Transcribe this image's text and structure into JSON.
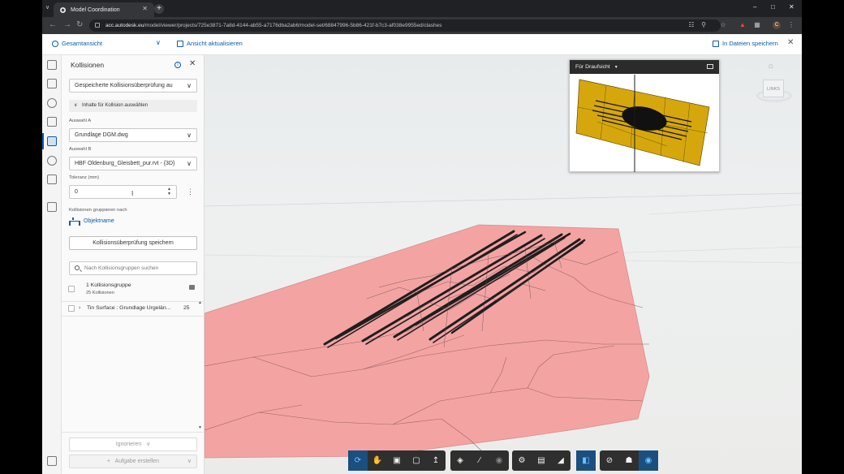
{
  "browser": {
    "tab_title": "Model Coordination",
    "url_host": "acc.autodesk.eu",
    "url_path": "/model/viewer/projects/725e3871-7a8d-4144-ab55-a7176dba2ab6/model-set/68847996-5b86-421f-b7c3-af038e9955ed/clashes",
    "profile_initial": "C"
  },
  "header": {
    "view_selector": "Gesamtansicht",
    "refresh_label": "Ansicht aktualisieren",
    "save_label": "In Dateien speichern"
  },
  "panel": {
    "title": "Kollisionen",
    "saved_dropdown": "Gespeicherte Kollisionsüberprüfung au",
    "section_label": "Inhalte für Kollision auswählen",
    "selection_a_label": "Auswahl A",
    "selection_a_value": "Grundlage DGM.dwg",
    "selection_b_label": "Auswahl B",
    "selection_b_value": "HBF Oldenburg_Gleisbett_pur.rvt - {3D}",
    "tolerance_label": "Toleranz (mm)",
    "tolerance_value": "0",
    "group_by_label": "Kollisionen gruppieren nach",
    "group_by_value": "Objektname",
    "save_button": "Kollisionsüberprüfung speichern",
    "search_placeholder": "Nach Kollisionsgruppen suchen",
    "group_name": "1 Kollisionsgruppe",
    "group_count": "25 Kollisionen",
    "row_name": "Tin Surface : Grundlage Urgelän...",
    "row_count": "25",
    "ignore_button": "Ignorieren",
    "task_button": "Aufgabe erstellen"
  },
  "viewer": {
    "minimap_title": "Für Draufsicht",
    "viewcube_label": "LINKS"
  },
  "toolbar_icons": [
    "orbit-icon",
    "pan-icon",
    "fit-icon",
    "zoom-window-icon",
    "walk-icon",
    "section-icon",
    "measure-icon",
    "explode-icon",
    "settings-icon",
    "save-view-icon",
    "markup-icon",
    "sheets-icon",
    "hide-icon",
    "properties-icon",
    "clash-icon"
  ],
  "colors": {
    "accent": "#0a5ca8",
    "surface": "#f4a3a3",
    "minimap_fill": "#d6a70d"
  }
}
